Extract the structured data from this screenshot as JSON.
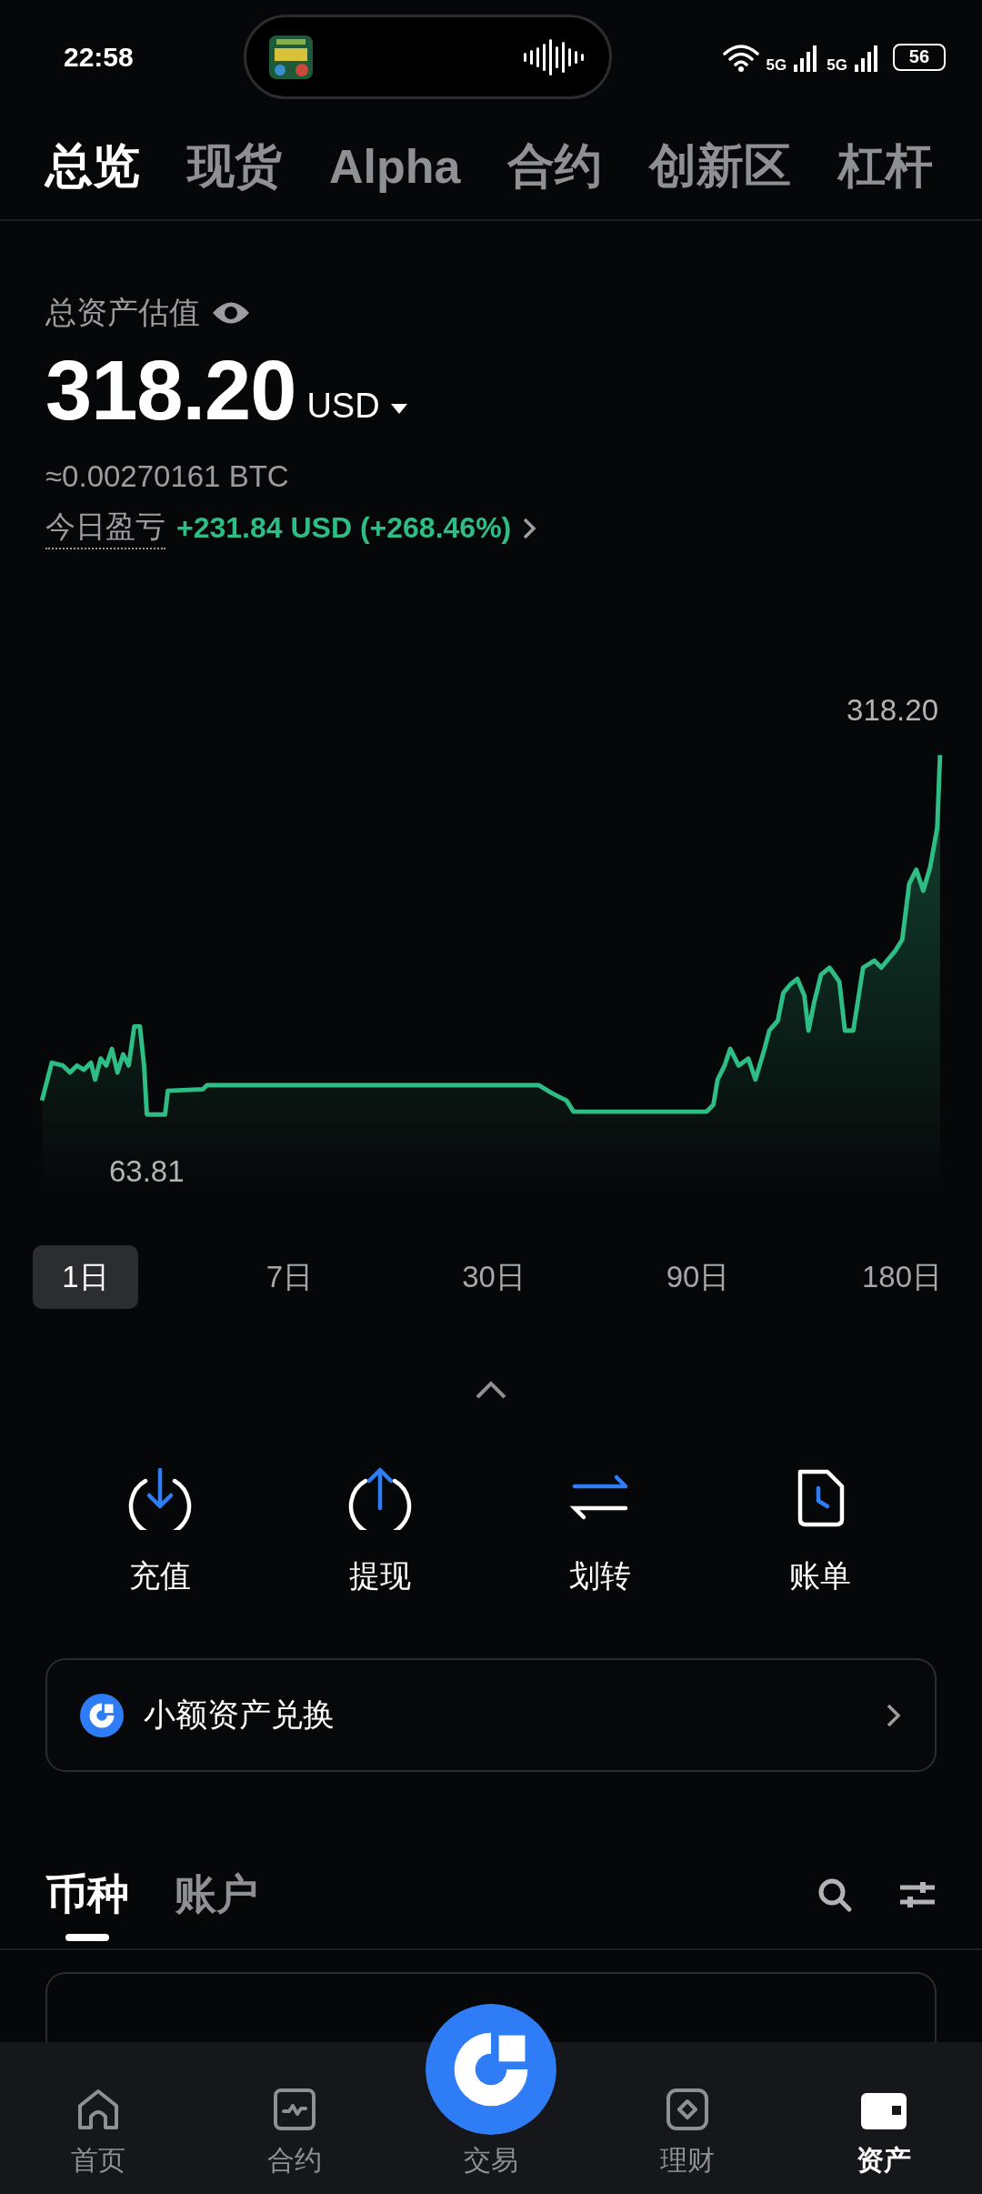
{
  "status_bar": {
    "time": "22:58",
    "network_1": "5G",
    "network_2": "5G",
    "battery": "56"
  },
  "top_tabs": [
    {
      "label": "总览",
      "selected": true
    },
    {
      "label": "现货",
      "selected": false
    },
    {
      "label": "Alpha",
      "selected": false
    },
    {
      "label": "合约",
      "selected": false
    },
    {
      "label": "创新区",
      "selected": false
    },
    {
      "label": "杠杆",
      "selected": false
    }
  ],
  "summary": {
    "title": "总资产估值",
    "value": "318.20",
    "currency": "USD",
    "btc": "≈0.00270161 BTC",
    "pnl_label": "今日盈亏",
    "pnl_value": "+231.84 USD (+268.46%)"
  },
  "chart": {
    "max_label": "318.20",
    "min_label": "63.81"
  },
  "periods": [
    {
      "label": "1日",
      "selected": true
    },
    {
      "label": "7日",
      "selected": false
    },
    {
      "label": "30日",
      "selected": false
    },
    {
      "label": "90日",
      "selected": false
    },
    {
      "label": "180日",
      "selected": false
    }
  ],
  "actions": [
    {
      "kind": "deposit",
      "label": "充值"
    },
    {
      "kind": "withdraw",
      "label": "提现"
    },
    {
      "kind": "transfer",
      "label": "划转"
    },
    {
      "kind": "bill",
      "label": "账单"
    }
  ],
  "convert_card": {
    "label": "小额资产兑换"
  },
  "asset_tabs": [
    {
      "label": "币种",
      "selected": true
    },
    {
      "label": "账户",
      "selected": false
    }
  ],
  "bottom_nav": [
    {
      "kind": "home",
      "label": "首页",
      "selected": false
    },
    {
      "kind": "futures",
      "label": "合约",
      "selected": false
    },
    {
      "kind": "trade",
      "label": "交易",
      "selected": false
    },
    {
      "kind": "earn",
      "label": "理财",
      "selected": false
    },
    {
      "kind": "assets",
      "label": "资产",
      "selected": true
    }
  ]
}
